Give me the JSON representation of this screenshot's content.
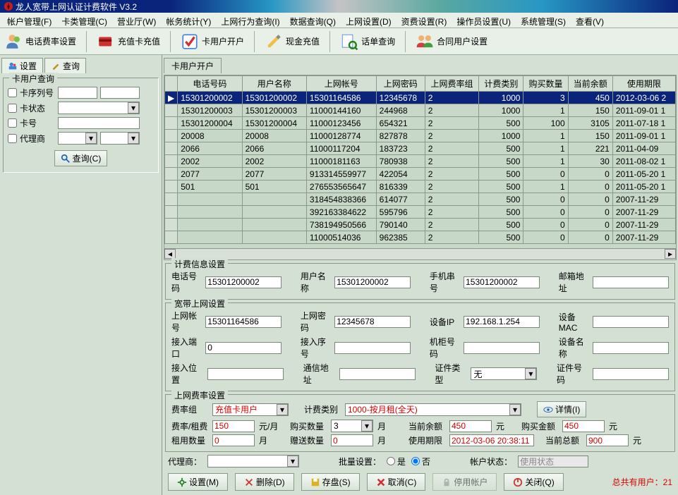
{
  "title": "龙人宽带上网认证计费软件 V3.2",
  "menu": [
    "帐户管理(F)",
    "卡类管理(C)",
    "营业厅(W)",
    "帐务统计(Y)",
    "上网行为查询(I)",
    "数据查询(Q)",
    "上网设置(D)",
    "资费设置(R)",
    "操作员设置(U)",
    "系统管理(S)",
    "查看(V)"
  ],
  "toolbar": [
    {
      "label": "电话费率设置"
    },
    {
      "label": "充值卡充值"
    },
    {
      "label": "卡用户开户"
    },
    {
      "label": "现金充值"
    },
    {
      "label": "话单查询"
    },
    {
      "label": "合同用户设置"
    }
  ],
  "left_tabs": {
    "settings": "设置",
    "query": "查询"
  },
  "left_panel": {
    "title": "卡用户查询",
    "rows": [
      {
        "label": "卡序列号"
      },
      {
        "label": "卡状态"
      },
      {
        "label": "卡号"
      },
      {
        "label": "代理商"
      }
    ],
    "search_btn": "查询(C)"
  },
  "right_tab": "卡用户开户",
  "grid": {
    "cols": [
      "电话号码",
      "用户名称",
      "上网帐号",
      "上网密码",
      "上网费率组",
      "计费类别",
      "购买数量",
      "当前余额",
      "使用期限"
    ],
    "rows": [
      [
        "15301200002",
        "15301200002",
        "15301164586",
        "12345678",
        "2",
        "1000",
        "3",
        "450",
        "2012-03-06 2"
      ],
      [
        "15301200003",
        "15301200003",
        "11000144160",
        "244968",
        "2",
        "1000",
        "1",
        "150",
        "2011-09-01 1"
      ],
      [
        "15301200004",
        "15301200004",
        "11000123456",
        "654321",
        "2",
        "500",
        "100",
        "3105",
        "2011-07-18 1"
      ],
      [
        "20008",
        "20008",
        "11000128774",
        "827878",
        "2",
        "1000",
        "1",
        "150",
        "2011-09-01 1"
      ],
      [
        "2066",
        "2066",
        "11000117204",
        "183723",
        "2",
        "500",
        "1",
        "221",
        "2011-04-09"
      ],
      [
        "2002",
        "2002",
        "11000181163",
        "780938",
        "2",
        "500",
        "1",
        "30",
        "2011-08-02 1"
      ],
      [
        "2077",
        "2077",
        "913314559977",
        "422054",
        "2",
        "500",
        "0",
        "0",
        "2011-05-20 1"
      ],
      [
        "501",
        "501",
        "276553565647",
        "816339",
        "2",
        "500",
        "1",
        "0",
        "2011-05-20 1"
      ],
      [
        "",
        "",
        "318454838366",
        "614077",
        "2",
        "500",
        "0",
        "0",
        "2007-11-29"
      ],
      [
        "",
        "",
        "392163384622",
        "595796",
        "2",
        "500",
        "0",
        "0",
        "2007-11-29"
      ],
      [
        "",
        "",
        "738194950566",
        "790140",
        "2",
        "500",
        "0",
        "0",
        "2007-11-29"
      ],
      [
        "",
        "",
        "11000514036",
        "962385",
        "2",
        "500",
        "0",
        "0",
        "2007-11-29"
      ]
    ]
  },
  "g1": {
    "title": "计费信息设置",
    "phone_l": "电话号码",
    "phone": "15301200002",
    "uname_l": "用户名称",
    "uname": "15301200002",
    "imei_l": "手机串号",
    "imei": "15301200002",
    "email_l": "邮箱地址"
  },
  "g2": {
    "title": "宽带上网设置",
    "acct_l": "上网帐号",
    "acct": "15301164586",
    "pwd_l": "上网密码",
    "pwd": "12345678",
    "ip_l": "设备IP",
    "ip": "192.168.1.254",
    "mac_l": "设备MAC",
    "port_l": "接入端口",
    "port": "0",
    "seq_l": "接入序号",
    "cab_l": "机柜号码",
    "devn_l": "设备名称",
    "pos_l": "接入位置",
    "addr_l": "通信地址",
    "idtype_l": "证件类型",
    "idtype": "无",
    "idno_l": "证件号码"
  },
  "g3": {
    "title": "上网费率设置",
    "rate_grp_l": "费率组",
    "rate_grp": "充值卡用户",
    "bill_type_l": "计费类别",
    "bill_type": "1000-按月租(全天)",
    "detail_btn": "详情(I)",
    "rate_l": "费率/租费",
    "rate": "150",
    "rate_unit": "元/月",
    "buy_qty_l": "购买数量",
    "buy_qty": "3",
    "buy_qty_unit": "月",
    "balance_l": "当前余额",
    "balance": "450",
    "balance_unit": "元",
    "buy_amt_l": "购买金额",
    "buy_amt": "450",
    "buy_amt_unit": "元",
    "rent_qty_l": "租用数量",
    "rent_qty": "0",
    "rent_qty_unit": "月",
    "gift_qty_l": "赠送数量",
    "gift_qty": "0",
    "gift_qty_unit": "月",
    "expire_l": "使用期限",
    "expire": "2012-03-06 20:38:11",
    "total_l": "当前总额",
    "total": "900",
    "total_unit": "元"
  },
  "bottom": {
    "agent_l": "代理商：",
    "batch_l": "批量设置：",
    "yes": "是",
    "no": "否",
    "status_l": "帐户状态：",
    "status_v": "使用状态"
  },
  "btns": {
    "set": "设置(M)",
    "del": "删除(D)",
    "save": "存盘(S)",
    "cancel": "取消(C)",
    "disable": "停用帐户",
    "close": "关闭(Q)"
  },
  "footer": "总共有用户：21"
}
